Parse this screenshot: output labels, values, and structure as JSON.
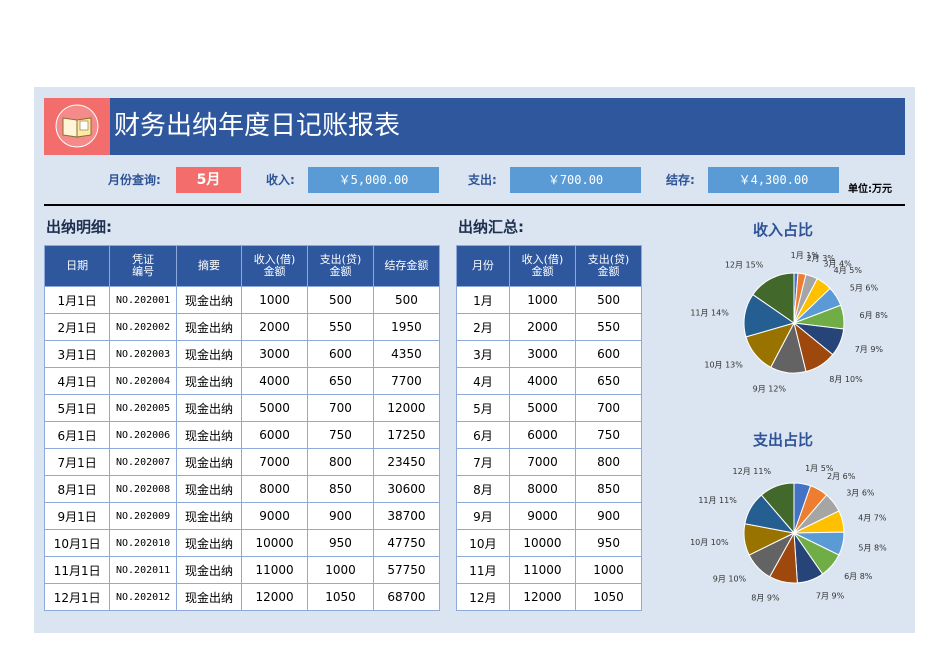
{
  "title": "财务出纳年度日记账报表",
  "filter": {
    "month_label": "月份查询:",
    "month_value": "5月",
    "income_label": "收入:",
    "income_value": "￥5,000.00",
    "expense_label": "支出:",
    "expense_value": "￥700.00",
    "balance_label": "结存:",
    "balance_value": "￥4,300.00",
    "unit": "单位:万元"
  },
  "detail": {
    "title": "出纳明细:",
    "columns": [
      "日期",
      "凭证\n编号",
      "摘要",
      "收入(借)\n金额",
      "支出(贷)\n金额",
      "结存金额"
    ],
    "rows": [
      [
        "1月1日",
        "NO.202001",
        "现金出纳",
        "1000",
        "500",
        "500"
      ],
      [
        "2月1日",
        "NO.202002",
        "现金出纳",
        "2000",
        "550",
        "1950"
      ],
      [
        "3月1日",
        "NO.202003",
        "现金出纳",
        "3000",
        "600",
        "4350"
      ],
      [
        "4月1日",
        "NO.202004",
        "现金出纳",
        "4000",
        "650",
        "7700"
      ],
      [
        "5月1日",
        "NO.202005",
        "现金出纳",
        "5000",
        "700",
        "12000"
      ],
      [
        "6月1日",
        "NO.202006",
        "现金出纳",
        "6000",
        "750",
        "17250"
      ],
      [
        "7月1日",
        "NO.202007",
        "现金出纳",
        "7000",
        "800",
        "23450"
      ],
      [
        "8月1日",
        "NO.202008",
        "现金出纳",
        "8000",
        "850",
        "30600"
      ],
      [
        "9月1日",
        "NO.202009",
        "现金出纳",
        "9000",
        "900",
        "38700"
      ],
      [
        "10月1日",
        "NO.202010",
        "现金出纳",
        "10000",
        "950",
        "47750"
      ],
      [
        "11月1日",
        "NO.202011",
        "现金出纳",
        "11000",
        "1000",
        "57750"
      ],
      [
        "12月1日",
        "NO.202012",
        "现金出纳",
        "12000",
        "1050",
        "68700"
      ]
    ]
  },
  "summary": {
    "title": "出纳汇总:",
    "columns": [
      "月份",
      "收入(借)\n金额",
      "支出(贷)\n金额"
    ],
    "rows": [
      [
        "1月",
        "1000",
        "500"
      ],
      [
        "2月",
        "2000",
        "550"
      ],
      [
        "3月",
        "3000",
        "600"
      ],
      [
        "4月",
        "4000",
        "650"
      ],
      [
        "5月",
        "5000",
        "700"
      ],
      [
        "6月",
        "6000",
        "750"
      ],
      [
        "7月",
        "7000",
        "800"
      ],
      [
        "8月",
        "8000",
        "850"
      ],
      [
        "9月",
        "9000",
        "900"
      ],
      [
        "10月",
        "10000",
        "950"
      ],
      [
        "11月",
        "11000",
        "1000"
      ],
      [
        "12月",
        "12000",
        "1050"
      ]
    ]
  },
  "chart_data": [
    {
      "type": "pie",
      "title": "收入占比",
      "categories": [
        "1月",
        "2月",
        "3月",
        "4月",
        "5月",
        "6月",
        "7月",
        "8月",
        "9月",
        "10月",
        "11月",
        "12月"
      ],
      "values": [
        1000,
        2000,
        3000,
        4000,
        5000,
        6000,
        7000,
        8000,
        9000,
        10000,
        11000,
        12000
      ],
      "labels": [
        "1月 1%",
        "2月 3%",
        "3月 4%",
        "4月 5%",
        "5月 6%",
        "6月 8%",
        "7月 9%",
        "8月 10%",
        "9月 12%",
        "10月 13%",
        "11月 14%",
        "12月 15%"
      ]
    },
    {
      "type": "pie",
      "title": "支出占比",
      "categories": [
        "1月",
        "2月",
        "3月",
        "4月",
        "5月",
        "6月",
        "7月",
        "8月",
        "9月",
        "10月",
        "11月",
        "12月"
      ],
      "values": [
        500,
        550,
        600,
        650,
        700,
        750,
        800,
        850,
        900,
        950,
        1000,
        1050
      ],
      "labels": [
        "1月 5%",
        "2月 6%",
        "3月 6%",
        "4月 7%",
        "5月 8%",
        "6月 8%",
        "7月 9%",
        "8月 9%",
        "9月 10%",
        "10月 10%",
        "11月 11%",
        "12月 11%"
      ]
    }
  ],
  "colors": {
    "header": "#2e579d",
    "accent": "#f36d6d",
    "field": "#5b9bd5",
    "panel": "#dbe5f1",
    "pie": [
      "#4472c4",
      "#ed7d31",
      "#a5a5a5",
      "#ffc000",
      "#5b9bd5",
      "#70ad47",
      "#264478",
      "#9e480e",
      "#636363",
      "#997300",
      "#255e91",
      "#43682b"
    ]
  }
}
